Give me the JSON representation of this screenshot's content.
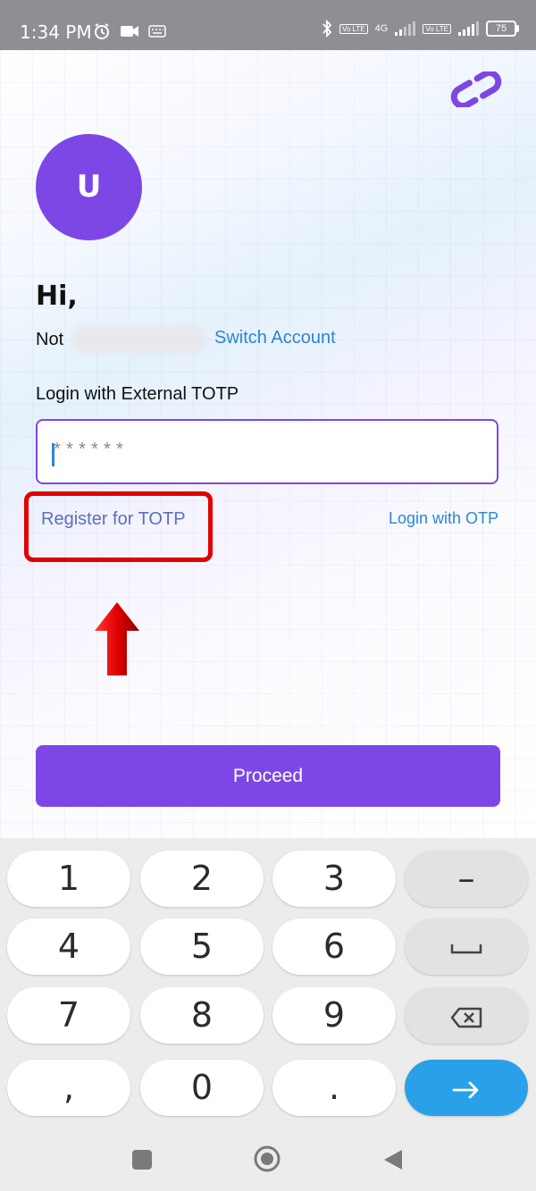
{
  "status_bar": {
    "time": "1:34 PM",
    "network": "4G",
    "volte_1": "Vo LTE",
    "volte_2": "Vo LTE",
    "battery": "75"
  },
  "login": {
    "avatar_initial": "U",
    "greeting": "Hi,",
    "not_label": "Not",
    "switch_account": "Switch Account",
    "totp_label": "Login with External TOTP",
    "totp_placeholder": "******",
    "register_totp": "Register for TOTP",
    "login_with_otp": "Login with OTP",
    "proceed": "Proceed"
  },
  "keyboard": {
    "row1": [
      "1",
      "2",
      "3",
      "–"
    ],
    "row2": [
      "4",
      "5",
      "6"
    ],
    "row3": [
      "7",
      "8",
      "9"
    ],
    "row4": [
      ",",
      "0",
      "."
    ],
    "space_icon": "space-icon",
    "backspace_icon": "backspace-icon",
    "enter_icon": "arrow-right-icon"
  },
  "colors": {
    "brand_purple": "#7d47e6",
    "link_blue": "#2b87d6",
    "highlight_red": "#e00000",
    "enter_key_blue": "#2aa0e8"
  }
}
